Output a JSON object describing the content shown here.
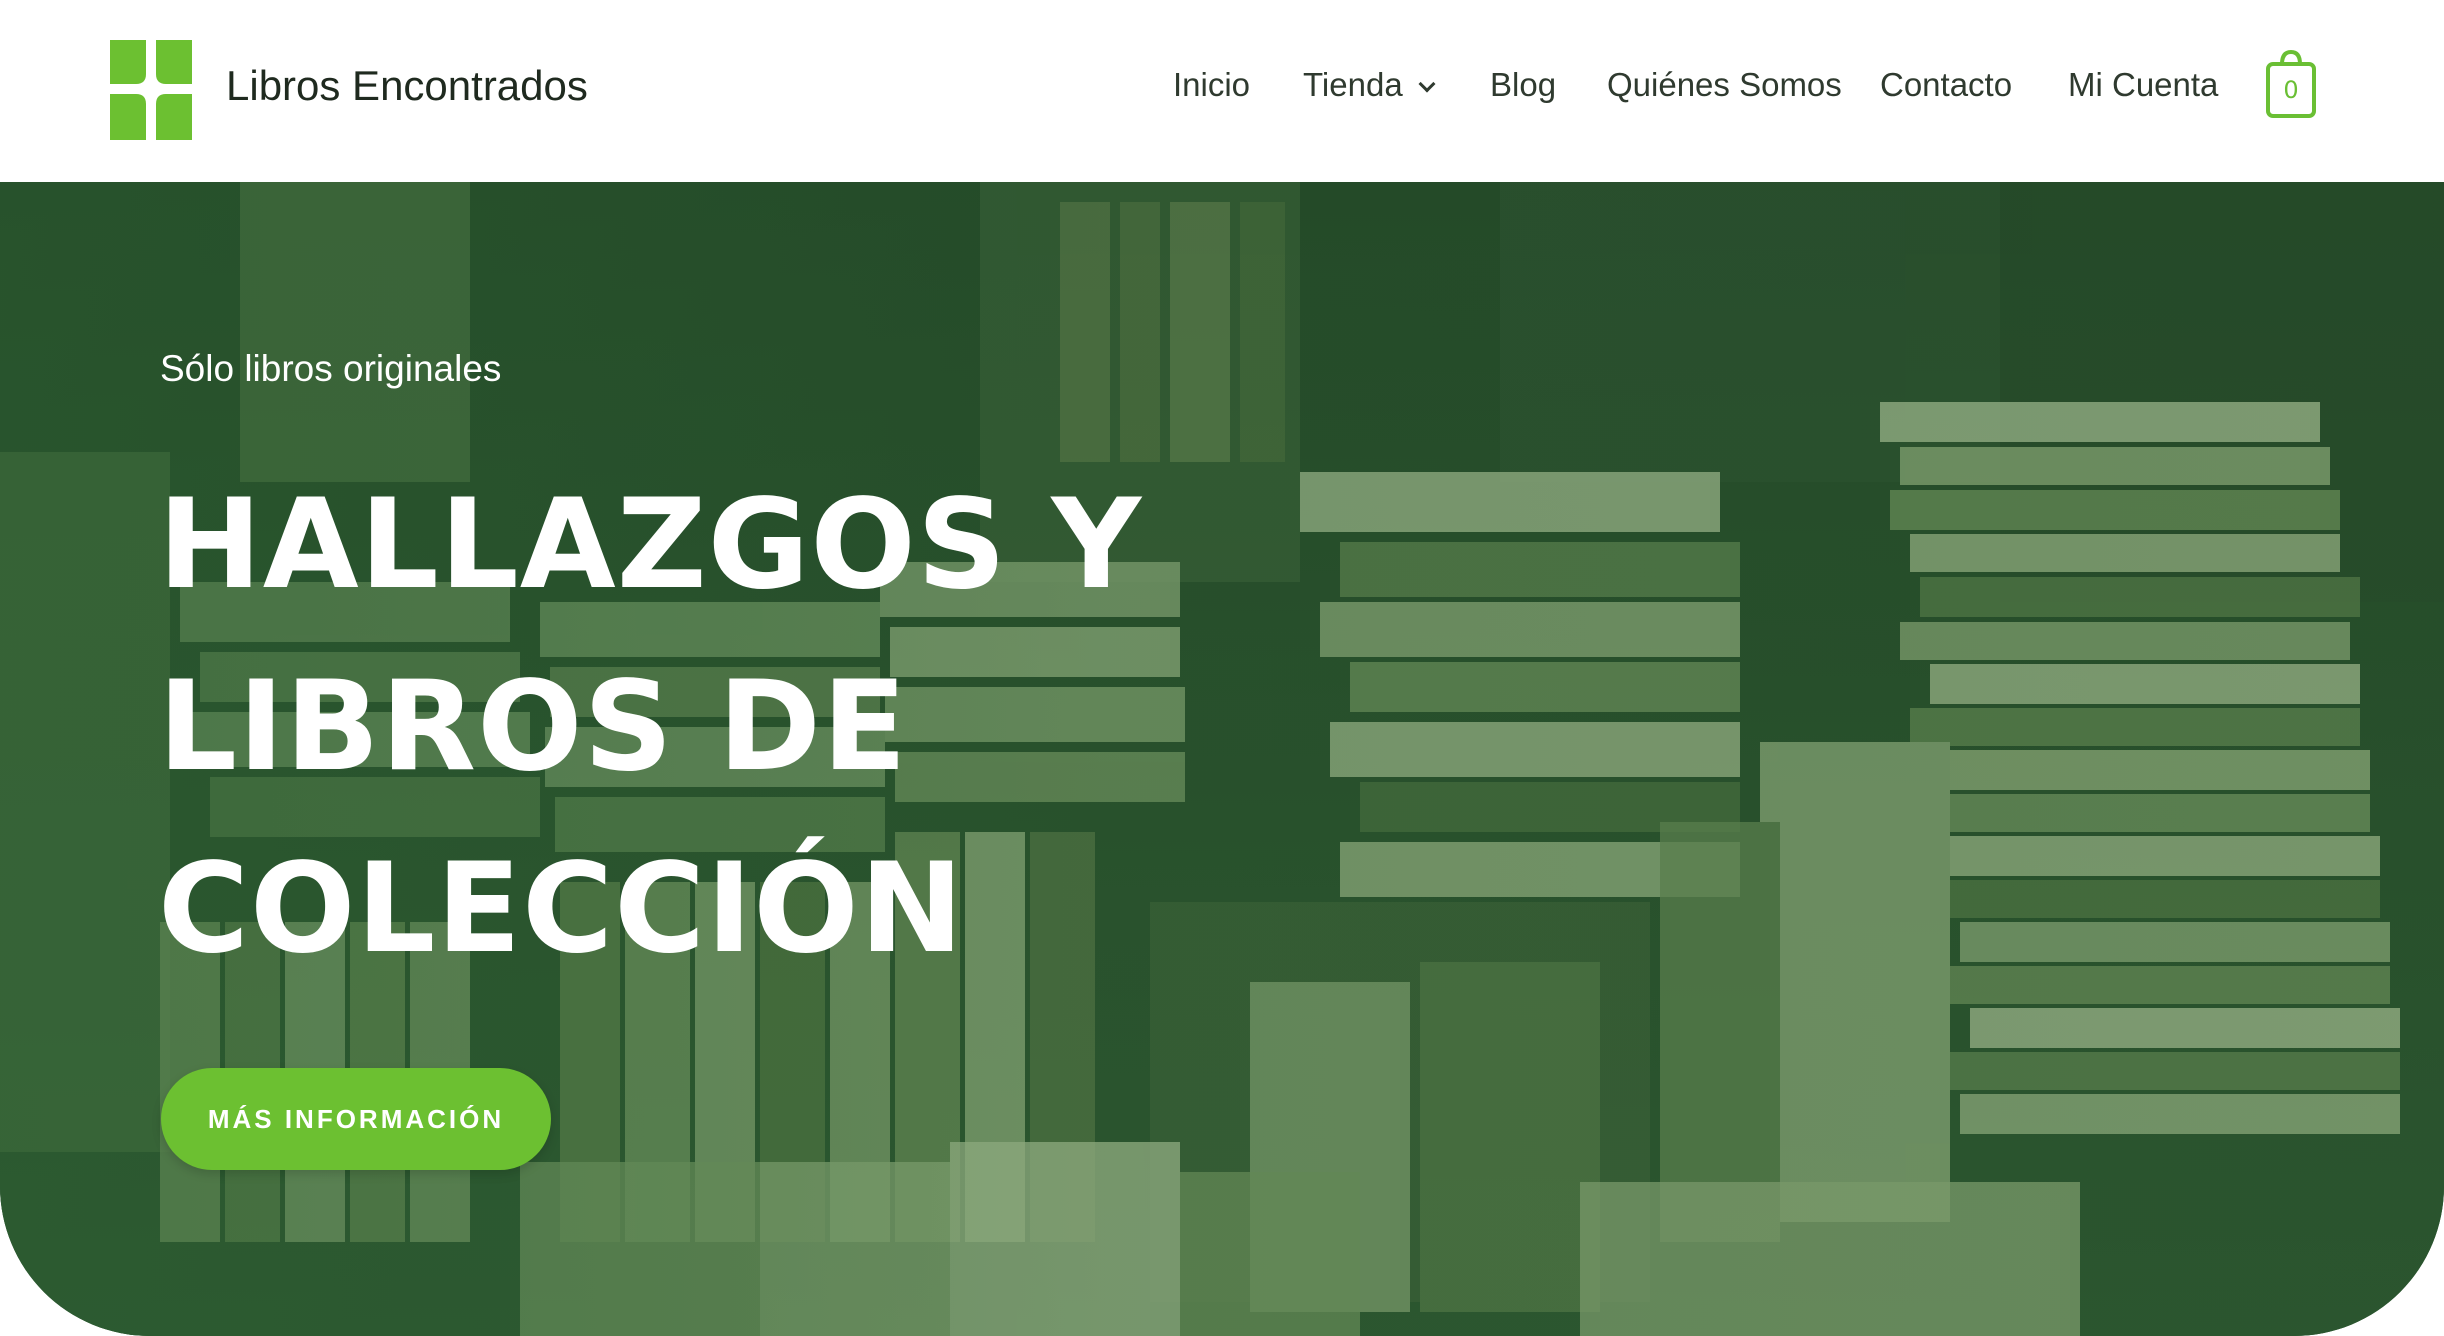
{
  "site": {
    "title": "Libros Encontrados"
  },
  "nav": {
    "items": [
      {
        "label": "Inicio"
      },
      {
        "label": "Tienda",
        "has_dropdown": true
      },
      {
        "label": "Blog"
      },
      {
        "label": "Quiénes Somos"
      },
      {
        "label": "Contacto"
      },
      {
        "label": "Mi Cuenta"
      }
    ],
    "cart_count": "0"
  },
  "hero": {
    "tagline": "Sólo libros originales",
    "headline_lines": [
      "HALLAZGOS Y",
      "LIBROS DE",
      "COLECCIÓN"
    ],
    "cta_label": "MÁS INFORMACIÓN"
  },
  "colors": {
    "accent": "#6cc031",
    "hero_tint": "#2e6434",
    "text_dark": "#2f3a2f"
  },
  "icons": {
    "logo": "four-leaf-squares-logo",
    "cart": "shopping-bag-icon",
    "dropdown": "chevron-down-icon"
  }
}
